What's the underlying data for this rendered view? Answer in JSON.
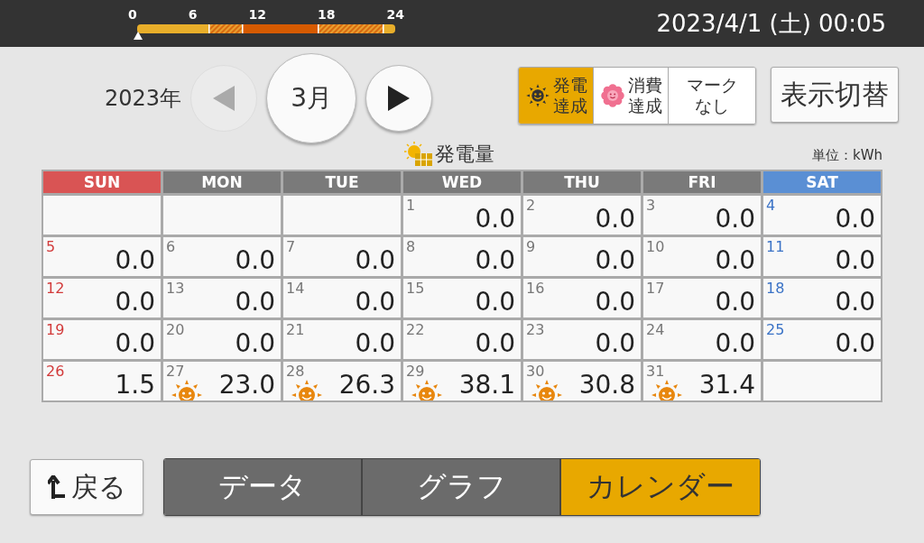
{
  "status_bar": {
    "timeline_ticks": [
      "0",
      "6",
      "12",
      "18",
      "24"
    ],
    "datetime": "2023/4/1 (土) 00:05"
  },
  "nav": {
    "year": "2023年",
    "month": "3月",
    "prev_disabled": true,
    "next_disabled": false
  },
  "mark_filter": [
    {
      "kind": "sun",
      "line1": "発電",
      "line2": "達成",
      "selected": true
    },
    {
      "kind": "flower",
      "line1": "消費",
      "line2": "達成",
      "selected": false
    },
    {
      "kind": "none",
      "line1": "マーク",
      "line2": "なし",
      "selected": false
    }
  ],
  "toggle_button": "表示切替",
  "calendar": {
    "title": "発電量",
    "unit": "単位：kWh",
    "columns": [
      {
        "label": "SUN",
        "kind": "sun"
      },
      {
        "label": "MON",
        "kind": "weekday"
      },
      {
        "label": "TUE",
        "kind": "weekday"
      },
      {
        "label": "WED",
        "kind": "weekday"
      },
      {
        "label": "THU",
        "kind": "weekday"
      },
      {
        "label": "FRI",
        "kind": "weekday"
      },
      {
        "label": "SAT",
        "kind": "sat"
      }
    ],
    "rows": [
      [
        {},
        {},
        {},
        {
          "day": "1",
          "value": "0.0"
        },
        {
          "day": "2",
          "value": "0.0"
        },
        {
          "day": "3",
          "value": "0.0"
        },
        {
          "day": "4",
          "value": "0.0"
        }
      ],
      [
        {
          "day": "5",
          "value": "0.0"
        },
        {
          "day": "6",
          "value": "0.0"
        },
        {
          "day": "7",
          "value": "0.0"
        },
        {
          "day": "8",
          "value": "0.0"
        },
        {
          "day": "9",
          "value": "0.0"
        },
        {
          "day": "10",
          "value": "0.0"
        },
        {
          "day": "11",
          "value": "0.0"
        }
      ],
      [
        {
          "day": "12",
          "value": "0.0"
        },
        {
          "day": "13",
          "value": "0.0"
        },
        {
          "day": "14",
          "value": "0.0"
        },
        {
          "day": "15",
          "value": "0.0"
        },
        {
          "day": "16",
          "value": "0.0"
        },
        {
          "day": "17",
          "value": "0.0"
        },
        {
          "day": "18",
          "value": "0.0"
        }
      ],
      [
        {
          "day": "19",
          "value": "0.0"
        },
        {
          "day": "20",
          "value": "0.0"
        },
        {
          "day": "21",
          "value": "0.0"
        },
        {
          "day": "22",
          "value": "0.0"
        },
        {
          "day": "23",
          "value": "0.0"
        },
        {
          "day": "24",
          "value": "0.0"
        },
        {
          "day": "25",
          "value": "0.0"
        }
      ],
      [
        {
          "day": "26",
          "value": "1.5",
          "sun": false
        },
        {
          "day": "27",
          "value": "23.0",
          "sun": true
        },
        {
          "day": "28",
          "value": "26.3",
          "sun": true
        },
        {
          "day": "29",
          "value": "38.1",
          "sun": true
        },
        {
          "day": "30",
          "value": "30.8",
          "sun": true
        },
        {
          "day": "31",
          "value": "31.4",
          "sun": true
        },
        {}
      ]
    ]
  },
  "back_button": "戻る",
  "tabs": [
    {
      "label": "データ",
      "selected": false
    },
    {
      "label": "グラフ",
      "selected": false
    },
    {
      "label": "カレンダー",
      "selected": true
    }
  ]
}
